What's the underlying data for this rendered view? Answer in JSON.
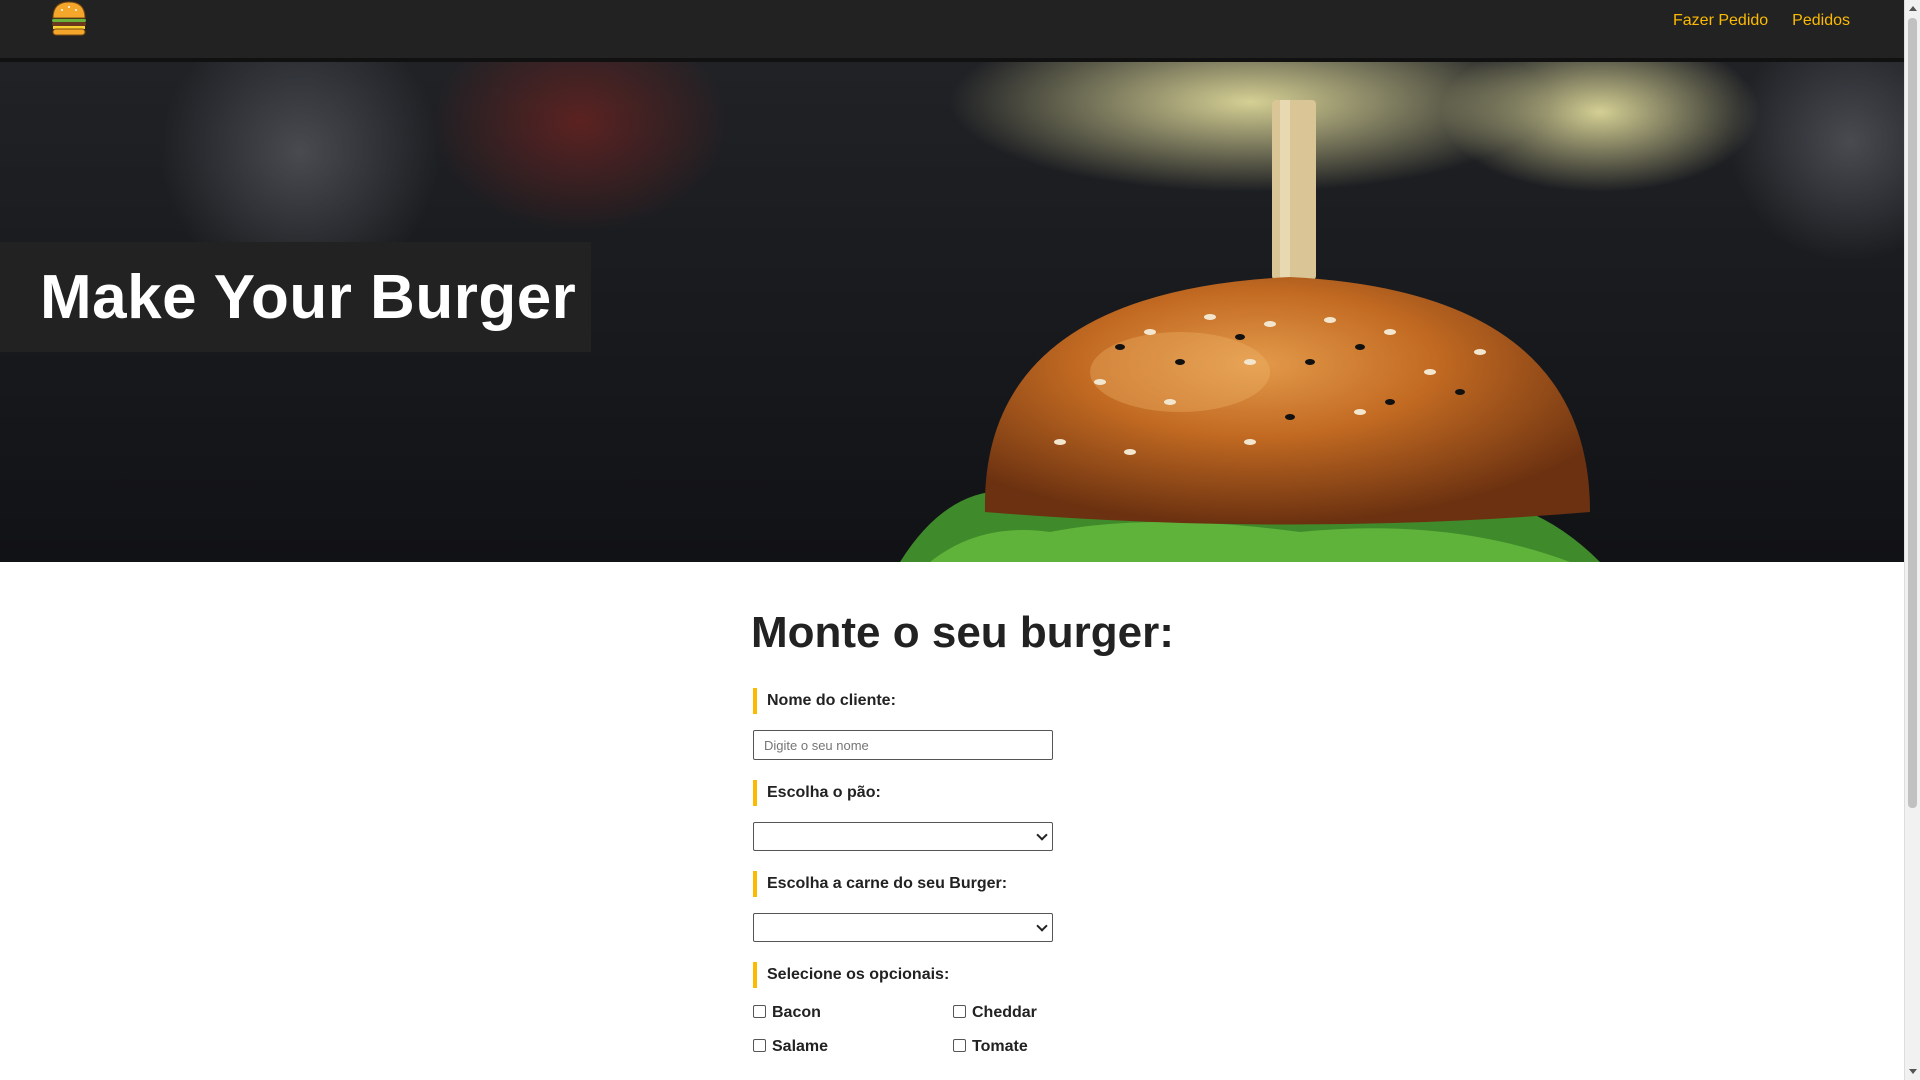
{
  "navbar": {
    "logo_icon": "burger-icon",
    "links": [
      {
        "label": "Fazer Pedido"
      },
      {
        "label": "Pedidos"
      }
    ],
    "accent_color": "#FCBA03",
    "background": "#222222"
  },
  "hero": {
    "title": "Make Your Burger",
    "image": "burger-photo"
  },
  "form": {
    "title": "Monte o seu burger:",
    "name_label": "Nome do cliente:",
    "name_placeholder": "Digite o seu nome",
    "name_value": "",
    "bread_label": "Escolha o pão:",
    "bread_selected": "",
    "meat_label": "Escolha a carne do seu Burger:",
    "meat_selected": "",
    "optionals_label": "Selecione os opcionais:",
    "optionals": [
      {
        "label": "Bacon",
        "checked": false
      },
      {
        "label": "Cheddar",
        "checked": false
      },
      {
        "label": "Salame",
        "checked": false
      },
      {
        "label": "Tomate",
        "checked": false
      }
    ]
  }
}
